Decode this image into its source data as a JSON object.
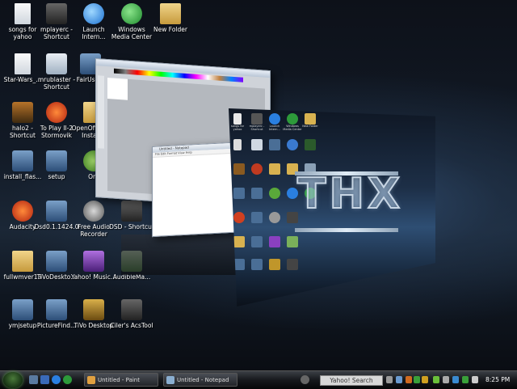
{
  "desktop_icons": [
    {
      "label": "songs for yahoo",
      "icon": "document-icon"
    },
    {
      "label": "mplayerc - Shortcut",
      "icon": "media-player-icon"
    },
    {
      "label": "Launch Intern...",
      "icon": "internet-explorer-icon"
    },
    {
      "label": "Windows Media Center",
      "icon": "media-center-icon"
    },
    {
      "label": "New Folder",
      "icon": "folder-icon"
    },
    {
      "label": "Star-Wars_...",
      "icon": "document-icon"
    },
    {
      "label": "mrublaster - Shortcut",
      "icon": "program-icon"
    },
    {
      "label": "FairUse...",
      "icon": "program-icon"
    },
    {
      "label": "halo2 - Shortcut",
      "icon": "halo-icon"
    },
    {
      "label": "To Play II-2 Stormovik",
      "icon": "game-icon"
    },
    {
      "label": "OpenOffi... 2.2 Install...",
      "icon": "folder-icon"
    },
    {
      "label": "install_flas...",
      "icon": "installer-icon"
    },
    {
      "label": "setup",
      "icon": "setup-icon"
    },
    {
      "label": "Orb",
      "icon": "orb-icon"
    },
    {
      "label": "Audacity",
      "icon": "audacity-icon"
    },
    {
      "label": "Dsd0.1.1424.0",
      "icon": "setup-icon"
    },
    {
      "label": "Free Audio Recorder",
      "icon": "speaker-icon"
    },
    {
      "label": "DSD - Shortcut",
      "icon": "program-icon"
    },
    {
      "label": "fullwmver13",
      "icon": "folder-icon"
    },
    {
      "label": "TiVoDeskto...",
      "icon": "setup-icon"
    },
    {
      "label": "Yahoo! Music...",
      "icon": "yahoo-music-icon"
    },
    {
      "label": "AudibleMa...",
      "icon": "audible-icon"
    },
    {
      "label": "ymjsetup",
      "icon": "setup-icon"
    },
    {
      "label": "PictureFind...",
      "icon": "setup-icon"
    },
    {
      "label": "TiVo Desktop",
      "icon": "tivo-icon"
    },
    {
      "label": "Ciler's AcsTool",
      "icon": "program-icon"
    }
  ],
  "windows": {
    "paint_title": "Untitled - Paint",
    "notepad_title": "Untitled - Notepad",
    "notepad_menu": "File  Edit  Format  View  Help"
  },
  "wallpaper_logo": "THX",
  "mini_desktop_icons": [
    {
      "label": "songs for yahoo"
    },
    {
      "label": "mplayerc - Shortcut"
    },
    {
      "label": "Launch Intern..."
    },
    {
      "label": "Windows Media Center"
    },
    {
      "label": "New Folder"
    }
  ],
  "taskbar": {
    "buttons": [
      {
        "label": "Untitled - Paint",
        "icon": "paint-icon"
      },
      {
        "label": "Untitled - Notepad",
        "icon": "notepad-icon"
      }
    ],
    "search_placeholder": "Yahoo! Search",
    "clock": "8:25 PM"
  },
  "colors": {
    "taskbar": "#16181c",
    "start_orb": "#4a7a3a",
    "wallpaper_glow": "#2f4a6c"
  }
}
